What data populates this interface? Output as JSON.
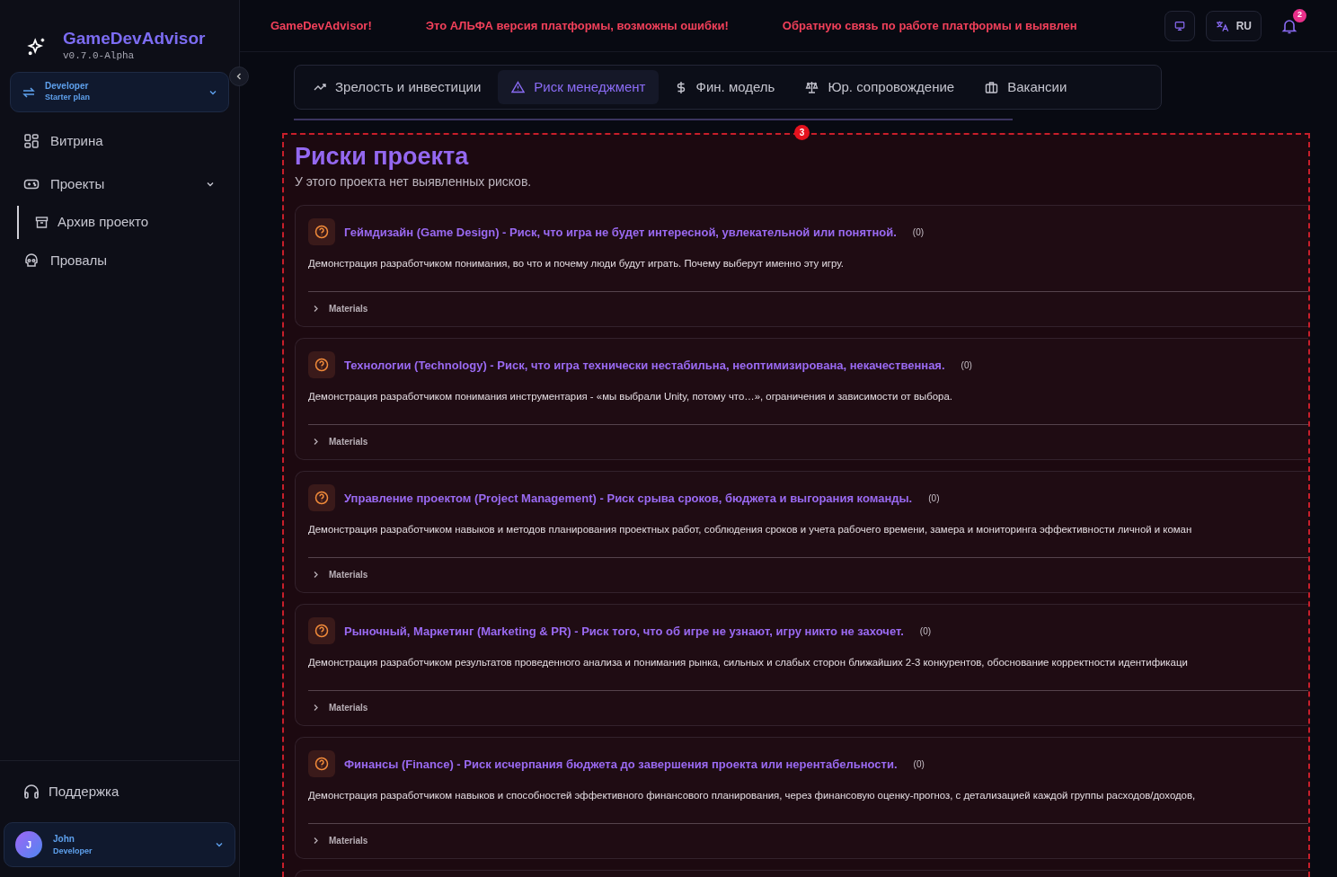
{
  "brand": {
    "name": "GameDevAdvisor",
    "version": "v0.7.0-Alpha"
  },
  "account": {
    "role": "Developer",
    "plan": "Starter plan"
  },
  "nav": [
    {
      "label": "Витрина"
    },
    {
      "label": "Проекты",
      "expanded": true,
      "children": [
        {
          "label": "Архив проекто"
        }
      ]
    },
    {
      "label": "Провалы"
    }
  ],
  "support": {
    "label": "Поддержка"
  },
  "user": {
    "initial": "J",
    "name": "John",
    "role": "Developer"
  },
  "banner": [
    "GameDevAdvisor!",
    "Это АЛЬФА версия платформы, возможны ошибки!",
    "Обратную связь по работе платформы и выявлен"
  ],
  "language": "RU",
  "notifications": "2",
  "tabs": [
    {
      "label": "Зрелость и инвестиции",
      "selected": false
    },
    {
      "label": "Риск менеджмент",
      "selected": true
    },
    {
      "label": "Фин. модель",
      "selected": false
    },
    {
      "label": "Юр. сопровождение",
      "selected": false
    },
    {
      "label": "Вакансии",
      "selected": false
    }
  ],
  "error_badge": "3",
  "section": {
    "title": "Риски проекта",
    "subtitle": "У этого проекта нет выявленных рисков."
  },
  "risks": [
    {
      "title": "Геймдизайн (Game Design) - Риск, что игра не будет интересной, увлекательной или понятной.",
      "count": "(0)",
      "description": "Демонстрация разработчиком понимания, во что и почему люди будут играть. Почему выберут именно эту игру.",
      "materials": "Materials",
      "expanded": false
    },
    {
      "title": "Технологии (Technology) - Риск, что игра технически нестабильна, неоптимизирована, некачественная.",
      "count": "(0)",
      "description": "Демонстрация разработчиком понимания инструментария - «мы выбрали Unity, потому что…», ограничения и зависимости от выбора.",
      "materials": "Materials",
      "expanded": false
    },
    {
      "title": "Управление проектом (Project Management) - Риск срыва сроков, бюджета и выгорания команды.",
      "count": "(0)",
      "description": "Демонстрация разработчиком навыков и методов планирования проектных работ, соблюдения сроков и учета рабочего времени, замера и мониторинга эффективности личной и коман",
      "materials": "Materials",
      "expanded": false
    },
    {
      "title": "Рыночный, Маркетинг (Marketing & PR) - Риск того, что об игре не узнают, игру никто не захочет.",
      "count": "(0)",
      "description": "Демонстрация разработчиком результатов проведенного анализа и понимания рынка, сильных и слабых сторон ближайших 2-3 конкурентов, обоснование корректности идентификаци",
      "materials": "Materials",
      "expanded": false
    },
    {
      "title": "Финансы (Finance) - Риск исчерпания бюджета до завершения проекта или нерентабельности.",
      "count": "(0)",
      "description": "Демонстрация разработчиком навыков и способностей эффективного финансового планирования, через финансовую оценку-прогноз, с детализацией каждой группы расходов/доходов,",
      "materials": "Materials",
      "expanded": false
    }
  ]
}
